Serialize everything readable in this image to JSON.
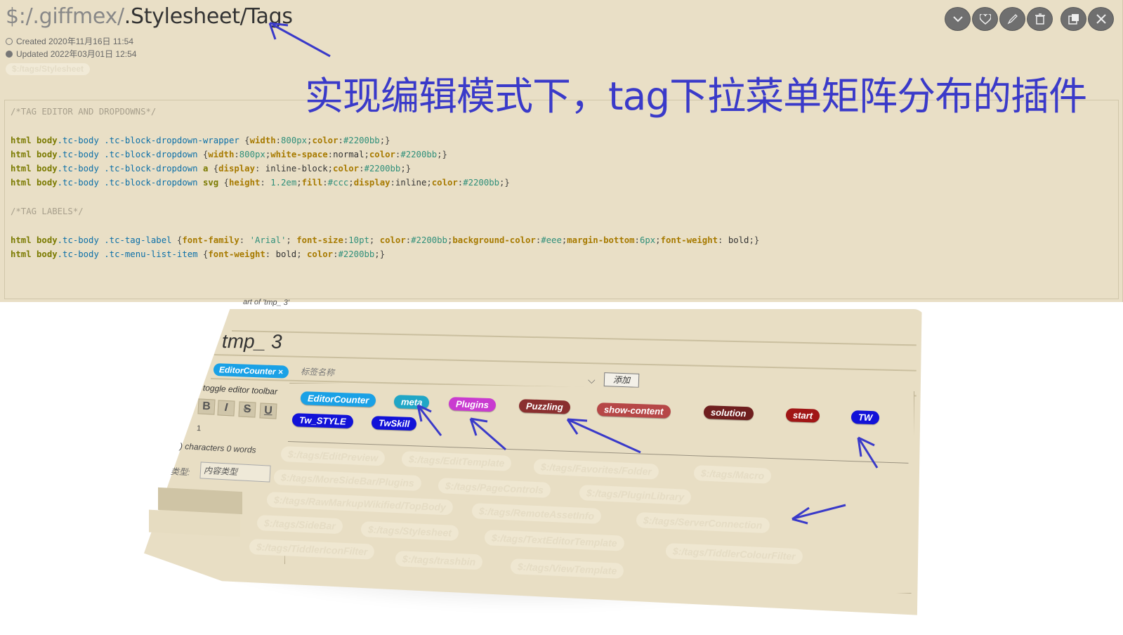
{
  "tiddler": {
    "title_prefix": "$:/.giffmex/",
    "title_rest": ".Stylesheet/Tags",
    "created": "Created 2020年11月16日 11:54",
    "updated": "Updated 2022年03月01日 12:54",
    "tag": "$:/tags/Stylesheet",
    "annotation": "实现编辑模式下，tag下拉菜单矩阵分布的插件"
  },
  "toolbar": {
    "icons": [
      "chevron-down-icon",
      "heart-icon",
      "edit-icon",
      "delete-icon",
      "open-window-icon",
      "close-icon"
    ],
    "glyphs": [
      "⌄",
      "♡",
      "✎",
      "🗑",
      "⧉",
      "✕"
    ]
  },
  "code": {
    "comment1": "/*TAG EDITOR AND DROPDOWNS*/",
    "comment2": "/*TAG LABELS*/"
  },
  "embedded": {
    "part_of": "art of 'tmp_ 3'",
    "title": "tmp_ 3",
    "editor_chip": "EditorCounter ×",
    "tag_name_placeholder": "标签名称",
    "add_button": "添加",
    "toggle_toolbar": "toggle editor toolbar",
    "format_buttons": [
      "B",
      "I",
      "S",
      "U"
    ],
    "line_number": "1",
    "char_count": ") characters    0 words",
    "type_label": "类型:",
    "type_placeholder": "内容类型",
    "tags": [
      {
        "label": "EditorCounter",
        "color": "#1aa1e6"
      },
      {
        "label": "meta",
        "color": "#20a6c6"
      },
      {
        "label": "Plugins",
        "color": "#c93bd0"
      },
      {
        "label": "Puzzling",
        "color": "#8a2f2f"
      },
      {
        "label": "show-content",
        "color": "#b64747"
      },
      {
        "label": "solution",
        "color": "#6f1f1f"
      },
      {
        "label": "start",
        "color": "#a11616"
      },
      {
        "label": "TW",
        "color": "#1212d8"
      },
      {
        "label": "Tw_STYLE",
        "color": "#1212d8"
      },
      {
        "label": "TwSkill",
        "color": "#1212d8"
      }
    ],
    "ghost_tags": [
      "$:/tags/EditPreview",
      "$:/tags/EditTemplate",
      "$:/tags/Favorites/Folder",
      "$:/tags/Macro",
      "$:/tags/MoreSideBar/Plugins",
      "$:/tags/PageControls",
      "$:/tags/PluginLibrary",
      "$:/tags/RawMarkupWikified/TopBody",
      "$:/tags/RemoteAssetInfo",
      "$:/tags/ServerConnection",
      "$:/tags/SideBar",
      "$:/tags/Stylesheet",
      "$:/tags/TextEditorTemplate",
      "$:/tags/TiddlerIconFilter",
      "$:/tags/trashbin",
      "$:/tags/ViewTemplate",
      "$:/tags/TiddlerColourFilter"
    ]
  }
}
